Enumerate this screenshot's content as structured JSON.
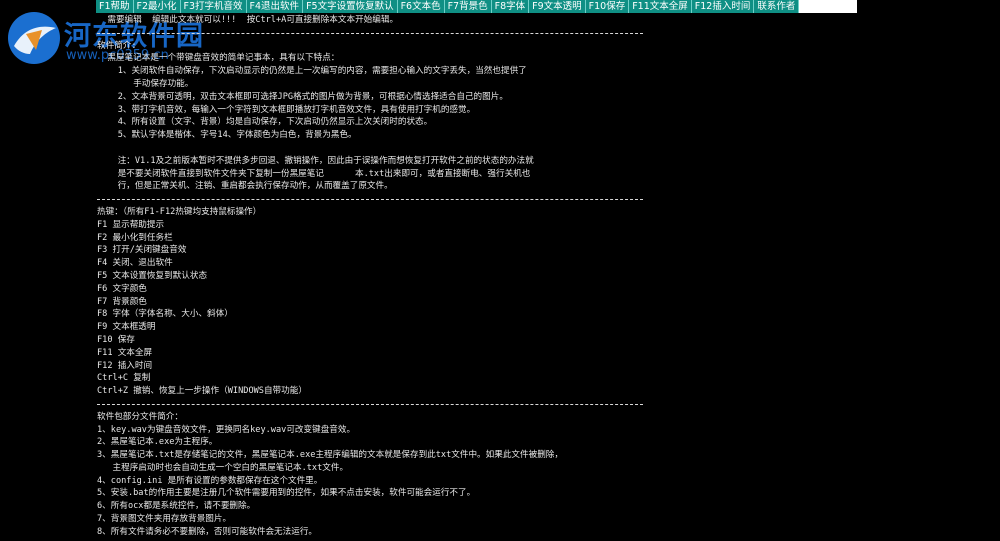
{
  "toolbar": {
    "buttons": [
      "F1帮助",
      "F2最小化",
      "F3打字机音效",
      "F4退出软件",
      "F5文字设置恢复默认",
      "F6文本色",
      "F7背景色",
      "F8字体",
      "F9文本透明",
      "F10保存",
      "F11文本全屏",
      "F12插入时间",
      "联系作者"
    ]
  },
  "watermark": {
    "title": "河东软件园",
    "url": "www.pc0359.cn"
  },
  "colors": {
    "toolbar_bg": "#0f8f84",
    "page_bg": "#000000",
    "text": "#e8e8e8",
    "watermark": "#1a6fd6"
  },
  "document": {
    "lines": [
      "  需要编辑  编辑此文本就可以!!!  按Ctrl+A可直接删除本文本开始编辑。",
      "---",
      "软件简介:",
      "  黑屋笔记本是一个带键盘音效的简单记事本，具有以下特点：",
      "    1、关闭软件自动保存，下次启动显示的仍然是上一次编写的内容，需要担心输入的文字丢失，当然也提供了",
      "       手动保存功能。",
      "    2、文本背景可透明，双击文本框即可选择JPG格式的图片做为背景，可根据心情选择适合自己的图片。",
      "    3、带打字机音效，每输入一个字符到文本框即播放打字机音效文件，具有使用打字机的感觉。",
      "    4、所有设置（文字、背景）均是自动保存，下次启动仍然显示上次关闭时的状态。",
      "    5、默认字体是楷体、字号14、字体颜色为白色，背景为黑色。",
      "",
      "    注：V1.1及之前版本暂时不提供多步回退、撤销操作，因此由于误操作而想恢复打开软件之前的状态的办法就",
      "    是不要关闭软件直接到软件文件夹下复制一份黑屋笔记      本.txt出来即可，或者直接断电、强行关机也",
      "    行，但是正常关机、注销、重启都会执行保存动作，从而覆盖了原文件。",
      "---",
      "热键：（所有F1-F12热键均支持鼠标操作）",
      "F1 显示帮助提示",
      "F2 最小化到任务栏",
      "F3 打开/关闭键盘音效",
      "F4 关闭、退出软件",
      "F5 文本设置恢复到默认状态",
      "F6 文字颜色",
      "F7 背景颜色",
      "F8 字体（字体名称、大小、斜体）",
      "F9 文本框透明",
      "F10 保存",
      "F11 文本全屏",
      "F12 插入时间",
      "Ctrl+C 复制",
      "Ctrl+Z 撤销、恢复上一步操作（WINDOWS自带功能）",
      "---",
      "软件包部分文件简介：",
      "1、key.wav为键盘音效文件，更换同名key.wav可改变键盘音效。",
      "2、黑屋笔记本.exe为主程序。",
      "3、黑屋笔记本.txt是存储笔记的文件，黑屋笔记本.exe主程序编辑的文本就是保存到此txt文件中。如果此文件被删除，",
      "   主程序启动时也会自动生成一个空白的黑屋笔记本.txt文件。",
      "4、config.ini 是所有设置的参数都保存在这个文件里。",
      "5、安装.bat的作用主要是注册几个软件需要用到的控件，如果不点击安装，软件可能会运行不了。",
      "6、所有ocx都是系统控件，请不要删除。",
      "7、背景图文件夹用存放背景图片。",
      "8、所有文件请务必不要删除，否则可能软件会无法运行。"
    ]
  }
}
